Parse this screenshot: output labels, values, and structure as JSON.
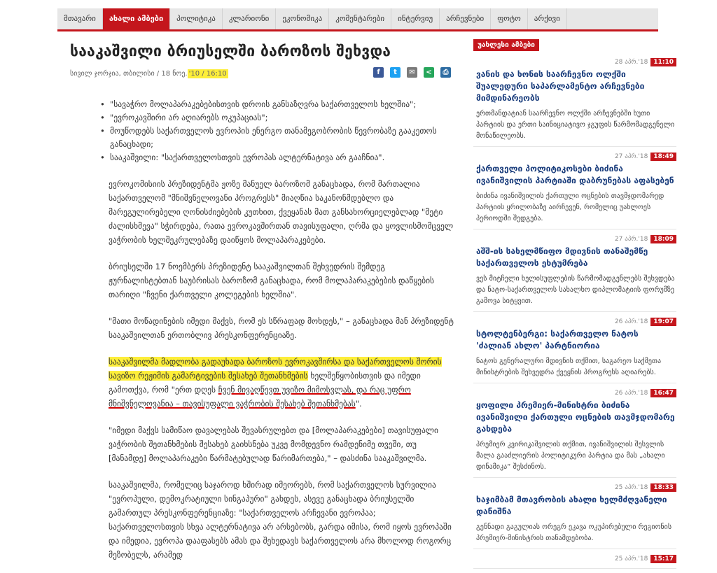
{
  "nav": {
    "items": [
      {
        "label": "მთავარი",
        "active": false
      },
      {
        "label": "ახალი ამბები",
        "active": true
      },
      {
        "label": "პოლიტიკა",
        "active": false
      },
      {
        "label": "კლარიონი",
        "active": false
      },
      {
        "label": "ეკონომიკა",
        "active": false
      },
      {
        "label": "კომენტარები",
        "active": false
      },
      {
        "label": "ინტერვიუ",
        "active": false
      },
      {
        "label": "არჩევნები",
        "active": false
      },
      {
        "label": "ფოტო",
        "active": false
      },
      {
        "label": "არქივი",
        "active": false
      }
    ]
  },
  "article": {
    "title": "სააკაშვილი ბრიუსელში ბაროზოს შეხვდა",
    "byline": "სივილ ჯორჯია, თბილისი / 18 ნოე.",
    "date_highlight": "'10 / 16:10",
    "bullets": [
      "\"სავაჭრო მოლაპარაკებებისთვის დროის განსაზღვრა საქართველოს ხელშია\";",
      "\"ევროკავშირი არ აღიარებს ოკუპაციას\";",
      "მოუწოდებს საქართველოს ევროპის ენერგო თანამეგობრობის წევრობაზე გააკეთოს განაცხადი;",
      "სააკაშვილი: \"საქართველოსთვის ევროპას ალტერნატივა არ გააჩნია\"."
    ],
    "p1": "ევროკომისიის პრეზიდენტმა ჟოზე მანუელ ბაროზომ განაცხადა, რომ მართალია საქართველომ \"მნიშვნელოვანი პროგრესს\" მიაღწია საკანონმდებლო და მარეგულირებელი ღონისძიებების კუთხით, ქვეყანას მათ განსახორციელებლად \"მეტი ძალისხმევა\" სჭირდება, რათა ევროკავშირთან თავისუფალი, ღრმა და ყოვლისმომცველ ვაჭრობის ხელშეკრულებაზე დაიწყოს მოლაპარაკებები.",
    "p2": "ბრიუსელში 17 ნოემბერს პრეზიდენტ სააკაშვილთან შეხვედრის შემდეგ ჟურნალისტებთან საუბრისას ბაროზომ განაცხადა, რომ მოლაპარაკებების დაწყების თარიღი \"ჩვენი ქართველი კოლეგების ხელშია\".",
    "p3": "\"მათი მოწადინების იმედი მაქვს, რომ ეს სწრაფად მოხდეს,\" – განაცხადა მან პრეზიდენტ სააკაშვილთან ერთობლივ პრესკონფერენციაზე.",
    "p4_hl": "სააკაშვილმა მადლობა გადაუხადა ბაროზოს ევროკავშირსა და საქართველოს შორის სავიზო რეჟიმის გამარტივების შესახებ შეთანხმების",
    "p4_a": " ხელშეწყობისთვის და იმედი გამოთქვა, რომ \"ერთ დღეს ",
    "p4_ul": "ჩვენ მივაღწევთ უვიზო მიმოსვლას, და რაც უფრო მნიშვნელოვანია – თავისუფალი ვაჭრობის შესახებ შეთანხმებას",
    "p4_b": "\".",
    "p5": "\"იმედი მაქვს სამიწაო დავალებას შევასრულებთ და [მოლაპარაკებები] თავისუფალი ვაჭრობის შეთანხმების შესახებ გაიხსნება უკვე მომდევნო რამდენიმე თვეში, თუ [მანამდე] მოლაპარაკები წარმატებულად წარიმართება,\" – დასძინა სააკაშვილმა.",
    "p6": "სააკაშვილმა, რომელიც საჯაროდ ხშირად იმეორებს, რომ საქართველოს სურვილია \"ევროპული, დემოკრატიული სინგაპური\" გახდეს, ასევე განაცხადა ბრიუსელში გამართულ პრესკონფერენციაზე: \"საქართველოს არჩევანი ევროპაა; საქართველოსთვის სხვა ალტერნატივა არ არსებობს, გარდა იმისა, რომ იყოს ევროპაში და იმედია, ევროპა დააფასებს ამას და შეხედავს საქართველოს არა მხოლოდ როგორც მეზობელს, არამედ"
  },
  "sidebar": {
    "heading": "უახლესი ამბები",
    "items": [
      {
        "date": "28 აპრ.'18",
        "time": "11:10",
        "title": "ვანის და ხონის საარჩევნო ოლქში შუალედური საპარლამენტო არჩევნები მიმდინარეობს",
        "desc": "ერთმანდატიან საარჩევნო ოლქში არჩევნებში ხუთი პარტიის და ერთი საინიციატივო ჯგუფის წარმომადგენელი მონაწილეობს."
      },
      {
        "date": "27 აპრ.'18",
        "time": "18:49",
        "title": "ქართველი პოლიტიკოსები ბიძინა ივანიშვილის პარტიაში დაბრუნებას აფასებენ",
        "desc": "ბიძინა ივანიშვილის ქართული ოცნების თავმჯდომარედ პარტიის ყრილობაზე აირჩევენ, რომელიც უახლოეს პერიოდში შედგება."
      },
      {
        "date": "27 აპრ.'18",
        "time": "18:09",
        "title": "აშშ-ის სახელმწიფო მდივნის თანაშემწე საქართველოს ეხტუმრება",
        "desc": "ვეს მიტჩელი ხელისუფლების წარმომადგენლებს შეხვდება და ნატო-საქართველოს სახალხო დიპლომატიის ფორუმზე გამოვა სიტყვით."
      },
      {
        "date": "26 აპრ.'18",
        "time": "19:07",
        "title": "სტოლტენბერგი: საქართველო ნატოს 'ძალიან ახლო' პარტნიორია",
        "desc": "ნატოს გენერალური მდივნის თქმით, საგარეო საქმეთა მინისტრების შეხვედრა ქვეყნის პროგრესს აღიარებს."
      },
      {
        "date": "26 აპრ.'18",
        "time": "16:47",
        "title": "ყოფილი პრემიერ-მინისტრი ბიძინა ივანიშვილი ქართული ოცნების თავმჯდომარე გახდება",
        "desc": "პრემიერ კვირიკაშვილის თქმით, ივანიშვილის შესვლის მალა გააძლიერის პოლიტიკური პარტია და მას „ახალი დინამიკა“ შესძინოს."
      },
      {
        "date": "25 აპრ.'18",
        "time": "18:33",
        "title": "ხაჯიმბამ მთავრობის ახალი ხელმძღვანელი დანიშნა",
        "desc": "გენნადი გაგულიას ორეგრ ეკავა ოკუპირებული რეგიონის პრემიერ-მინისტრის თანამდებობა."
      },
      {
        "date": "25 აპრ.'18",
        "time": "15:17",
        "title": "",
        "desc": ""
      }
    ]
  }
}
